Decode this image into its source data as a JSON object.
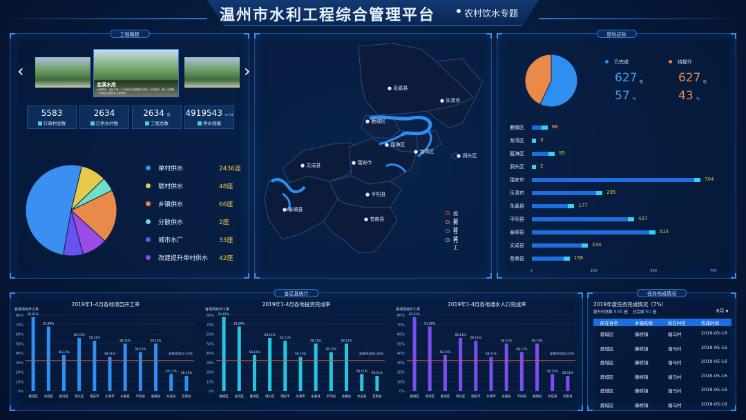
{
  "header": {
    "title": "温州市水利工程综合管理平台",
    "subtitle": "农村饮水专题"
  },
  "overview": {
    "panel_title": "工程概貌",
    "arrow_left": "‹",
    "arrow_right": "›",
    "featured": {
      "name": "金溪水库",
      "desc": "水库概况：地处于某一个水库区位地理条件说明，水质良好，第一水源第一水库区主要供水工程说明"
    },
    "stats": [
      {
        "value": "5583",
        "unit": "",
        "label": "行政村总数",
        "icon": "village-icon"
      },
      {
        "value": "2634",
        "unit": "",
        "label": "已供水村数",
        "icon": "grid-icon"
      },
      {
        "value": "2634",
        "unit": "座",
        "label": "工程总数",
        "icon": "bar-icon"
      },
      {
        "value": "4919543",
        "unit": "m³/d",
        "label": "供水规模",
        "icon": "drop-icon"
      }
    ],
    "pie": [
      {
        "label": "单村供水",
        "value": "2436座",
        "num": 2436,
        "color": "#3b8ff0"
      },
      {
        "label": "联村供水",
        "value": "48座",
        "num": 48,
        "color": "#e8c94b"
      },
      {
        "label": "乡镇供水",
        "value": "66座",
        "num": 66,
        "color": "#ea8a4a"
      },
      {
        "label": "分散供水",
        "value": "2座",
        "num": 2,
        "color": "#6fe0c8"
      },
      {
        "label": "城市水厂",
        "value": "33座",
        "num": 33,
        "color": "#6a52f0"
      },
      {
        "label": "改建提升单村供水",
        "value": "42座",
        "num": 42,
        "color": "#9a4be8"
      }
    ]
  },
  "map": {
    "regions": [
      "永嘉县",
      "乐清市",
      "鹿城区",
      "瓯海区",
      "龙湾区",
      "洞头区",
      "文成县",
      "瑞安市",
      "平阳县",
      "泰顺县",
      "苍南县"
    ],
    "legend": [
      {
        "label": "规划",
        "color": "#e04a8a"
      },
      {
        "label": "拟建",
        "color": "#e8a040"
      },
      {
        "label": "在建",
        "color": "#3b8ff0"
      },
      {
        "label": "完工",
        "color": "#6fe0c8"
      }
    ]
  },
  "target": {
    "panel_title": "提标达标",
    "done_label": "已完成",
    "todo_label": "待提升",
    "done_color": "#2f8ff0",
    "todo_color": "#ea8a4a",
    "done_count": "627",
    "todo_count": "627",
    "done_pct": "57",
    "todo_pct": "43",
    "count_unit": "座",
    "pct_unit": "%",
    "bars": [
      {
        "name": "鹿城区",
        "value": 66
      },
      {
        "name": "龙湾区",
        "value": 3
      },
      {
        "name": "瓯海区",
        "value": 95
      },
      {
        "name": "洞头区",
        "value": 2
      },
      {
        "name": "瑞安市",
        "value": 704
      },
      {
        "name": "乐清市",
        "value": 295
      },
      {
        "name": "永嘉县",
        "value": 177
      },
      {
        "name": "平阳县",
        "value": 427
      },
      {
        "name": "泰顺县",
        "value": 515
      },
      {
        "name": "文成县",
        "value": 234
      },
      {
        "name": "苍南县",
        "value": 158
      }
    ],
    "axis_ticks": [
      "0",
      "250",
      "500",
      "750"
    ]
  },
  "stats_panel": {
    "panel_title": "各区县统计"
  },
  "chart_data": [
    {
      "type": "bar",
      "title": "2019年1-4月各地项目开工率",
      "ylabel": "各地项目开工率",
      "categories": [
        "鹿城区",
        "龙湾区",
        "瓯海区",
        "洞头区",
        "瑞安市",
        "乐清市",
        "永嘉县",
        "平阳县",
        "泰顺县",
        "文成县",
        "苍南县"
      ],
      "values": [
        82.61,
        81.89,
        58.11,
        58.11,
        58.11,
        58.11,
        58.11,
        58.11,
        58.11,
        58.11,
        58.11
      ],
      "plotted": [
        78,
        68,
        38,
        56,
        53,
        36,
        50,
        41,
        50,
        18,
        16
      ],
      "avg_label": "全市平均32.22%",
      "avg": 32.22,
      "ylim": [
        0,
        80
      ],
      "yticks": [
        "0%",
        "10%",
        "20%",
        "30%",
        "40%",
        "50%",
        "60%",
        "70%",
        "80%"
      ],
      "color": "#2f8ff0"
    },
    {
      "type": "bar",
      "title": "2019年1-4月各地投资完成率",
      "ylabel": "各地项目开工率",
      "categories": [
        "鹿城区",
        "龙湾区",
        "瓯海区",
        "洞头区",
        "瑞安市",
        "乐清市",
        "永嘉县",
        "平阳县",
        "泰顺县",
        "文成县",
        "苍南县"
      ],
      "values": [
        82.61,
        81.89,
        58.11,
        58.11,
        58.11,
        58.11,
        58.11,
        58.11,
        58.11,
        58.11,
        58.11
      ],
      "plotted": [
        78,
        68,
        38,
        56,
        53,
        36,
        50,
        41,
        50,
        18,
        16
      ],
      "avg_label": "全市平均32.22%",
      "avg": 32.22,
      "ylim": [
        0,
        80
      ],
      "yticks": [
        "0%",
        "10%",
        "20%",
        "30%",
        "40%",
        "50%",
        "60%",
        "70%",
        "80%"
      ],
      "color": "#27c4e2"
    },
    {
      "type": "bar",
      "title": "2019年1-4月各地通水人口完成率",
      "ylabel": "各地项目开工率",
      "categories": [
        "鹿城区",
        "龙湾区",
        "瓯海区",
        "洞头区",
        "瑞安市",
        "乐清市",
        "永嘉县",
        "平阳县",
        "泰顺县",
        "文成县",
        "苍南县"
      ],
      "values": [
        82.61,
        81.89,
        58.11,
        58.11,
        58.11,
        58.11,
        58.11,
        58.11,
        58.11,
        58.11,
        58.11
      ],
      "plotted": [
        78,
        68,
        38,
        56,
        53,
        36,
        50,
        41,
        50,
        18,
        16
      ],
      "avg_label": "全市平均32.22%",
      "avg": 32.22,
      "ylim": [
        0,
        80
      ],
      "yticks": [
        "0%",
        "10%",
        "20%",
        "30%",
        "40%",
        "50%",
        "60%",
        "70%",
        "80%"
      ],
      "color": "#7b4ef0"
    }
  ],
  "task": {
    "panel_title": "任务完成情况",
    "heading": "2019年度任务完成情况（7%）",
    "plan_label": "提升村总数",
    "plan_value": "836",
    "plan_unit": "座",
    "done_label": "已完成",
    "done_value": "60",
    "done_unit": "座",
    "month": "6月",
    "columns": [
      "所在县名",
      "乡镇名称",
      "所在村名",
      "完成时间"
    ],
    "rows": [
      [
        "鹿城区",
        "藤桥镇",
        "塘马村",
        "2019-05-16"
      ],
      [
        "鹿城区",
        "藤桥镇",
        "塘马村",
        "2019-05-16"
      ],
      [
        "鹿城区",
        "藤桥镇",
        "塘马村",
        "2019-05-16"
      ],
      [
        "鹿城区",
        "藤桥镇",
        "塘马村",
        "2019-05-16"
      ],
      [
        "鹿城区",
        "藤桥镇",
        "塘马村",
        "2019-05-16"
      ],
      [
        "鹿城区",
        "藤桥镇",
        "塘马村",
        "2019-05-16"
      ]
    ]
  }
}
